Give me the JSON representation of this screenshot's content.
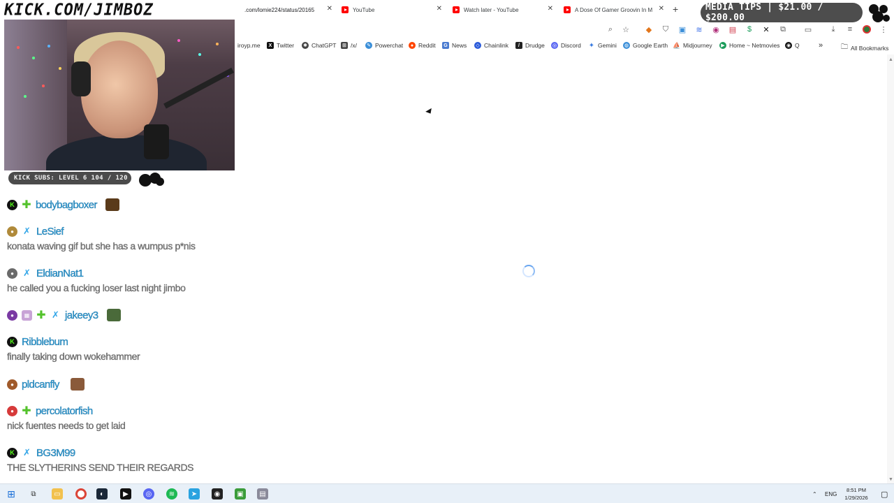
{
  "stream_overlay": {
    "banner_text": "KICK.COM/JIMBOZ",
    "subs_text": "KICK SUBS: LEVEL 6 104 / 120",
    "media_tips_text": "MEDIA TIPS | $21.00 / $200.00"
  },
  "browser": {
    "tabs": [
      {
        "label": ".com/lomie224/status/20165",
        "active": true
      },
      {
        "label": "YouTube",
        "active": false
      },
      {
        "label": "Watch later - YouTube",
        "active": false
      },
      {
        "label": "A Dose Of Gamer Groovin In M",
        "active": false
      }
    ],
    "new_tab_symbol": "+",
    "toolbar_icons": [
      "zoom-icon",
      "star-icon",
      "metamask-icon",
      "shield-icon",
      "extension-icon",
      "wave-icon",
      "extension2-icon",
      "toolbox-icon",
      "dollar-icon",
      "x-icon",
      "puzzle-icon",
      "sidepanel-icon",
      "download-icon",
      "media-icon",
      "profile-icon",
      "menu-icon"
    ],
    "bookmarks": [
      {
        "label": "iroyp.me",
        "icon": "globe-icon",
        "color": "#888888"
      },
      {
        "label": "Twitter",
        "icon": "x-icon",
        "color": "#111111"
      },
      {
        "label": "ChatGPT",
        "icon": "chatgpt-icon",
        "color": "#333333"
      },
      {
        "label": "/x/",
        "icon": "grid-icon",
        "color": "#444444"
      },
      {
        "label": "Powerchat",
        "icon": "powerchat-icon",
        "color": "#3a8ed8"
      },
      {
        "label": "Reddit",
        "icon": "reddit-icon",
        "color": "#ff4500"
      },
      {
        "label": "News",
        "icon": "news-icon",
        "color": "#4a7bd0"
      },
      {
        "label": "Chainlink",
        "icon": "chainlink-icon",
        "color": "#2a5ada"
      },
      {
        "label": "Drudge",
        "icon": "drudge-icon",
        "color": "#222222"
      },
      {
        "label": "Discord",
        "icon": "discord-icon",
        "color": "#5865f2"
      },
      {
        "label": "Gemini",
        "icon": "gemini-icon",
        "color": "#3a7be0"
      },
      {
        "label": "Google Earth",
        "icon": "earth-icon",
        "color": "#3a8ed8"
      },
      {
        "label": "Midjourney",
        "icon": "midjourney-icon",
        "color": "#333333"
      },
      {
        "label": "Home ~ Netmovies",
        "icon": "play-icon",
        "color": "#1a9c5a"
      },
      {
        "label": "Q",
        "icon": "q-icon",
        "color": "#111111"
      }
    ],
    "bookmarks_overflow": "»",
    "all_bookmarks_label": "All Bookmarks"
  },
  "chat": {
    "messages": [
      {
        "user": "bodybagboxer",
        "text": ""
      },
      {
        "user": "LeSief",
        "text": "konata waving gif but she has a wumpus p*nis"
      },
      {
        "user": "EldianNat1",
        "text": "he called you a fucking loser last night jimbo"
      },
      {
        "user": "jakeey3",
        "text": ""
      },
      {
        "user": "Ribblebum",
        "text": "finally taking down wokehammer"
      },
      {
        "user": "pldcanfly",
        "text": ""
      },
      {
        "user": "percolatorfish",
        "text": "nick fuentes needs to get laid"
      },
      {
        "user": "BG3M99",
        "text": "THE SLYTHERINS SEND THEIR REGARDS"
      }
    ]
  },
  "taskbar": {
    "language": "ENG",
    "time": "8:51 PM",
    "date": "1/29/2026"
  },
  "colors": {
    "username": "#2f9fd8",
    "kick_green": "#53fc18",
    "tips_bg": "#4d4d4d"
  }
}
